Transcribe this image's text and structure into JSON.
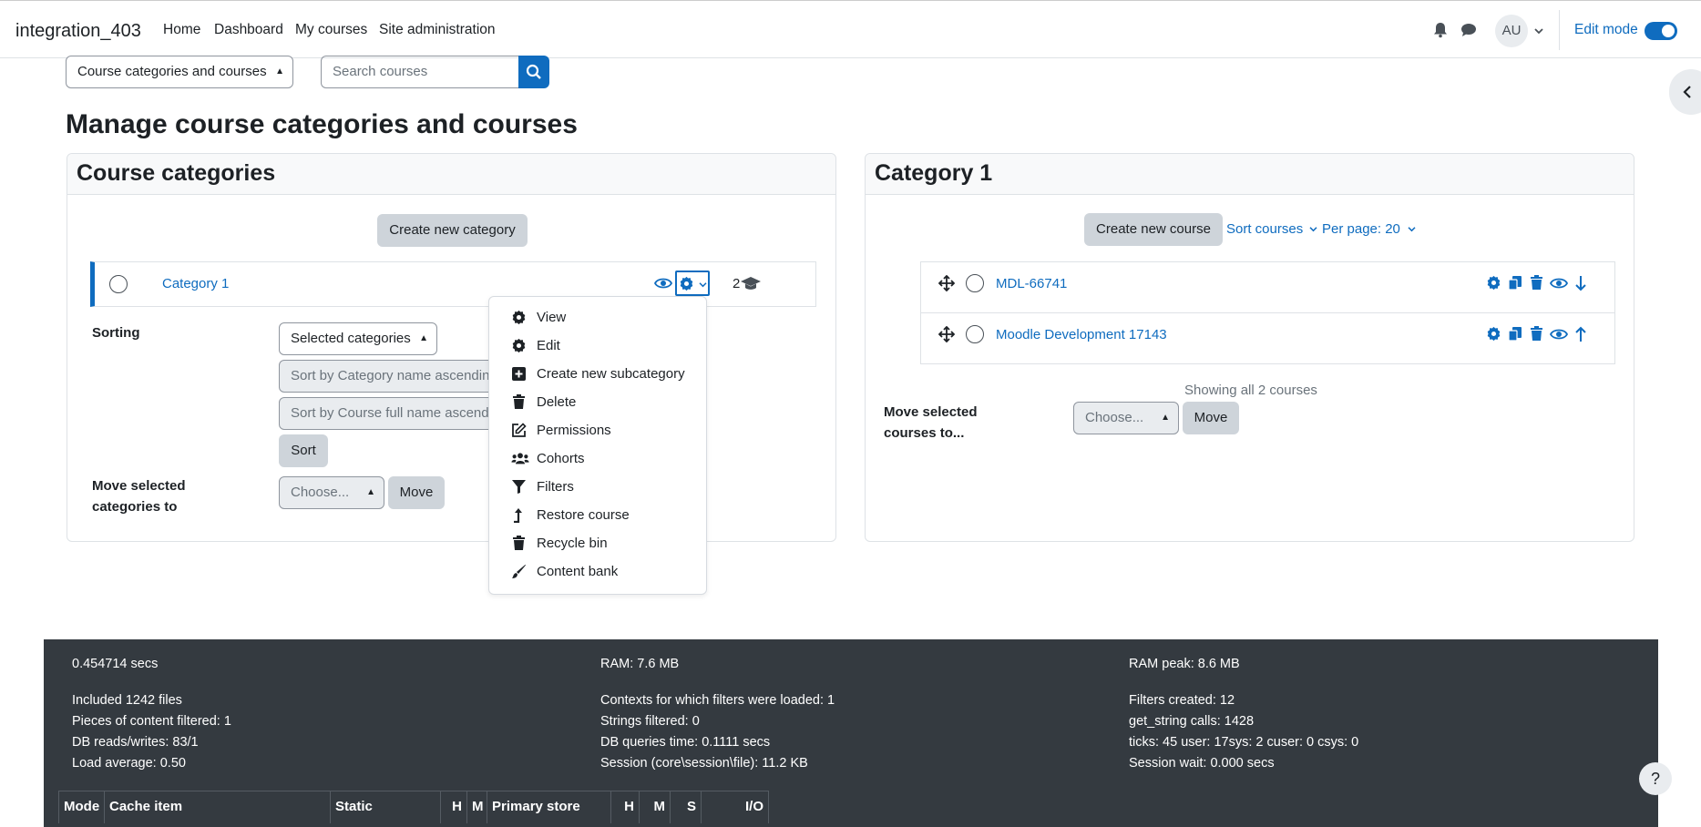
{
  "navbar": {
    "site_name": "integration_403",
    "links": [
      "Home",
      "Dashboard",
      "My courses",
      "Site administration"
    ],
    "avatar_initials": "AU",
    "edit_mode_label": "Edit mode"
  },
  "top_controls": {
    "view_select": "Course categories and courses",
    "search_placeholder": "Search courses"
  },
  "page_title": "Manage course categories and courses",
  "categories_panel": {
    "title": "Course categories",
    "create_button": "Create new category",
    "category": {
      "name": "Category 1",
      "course_count": "2"
    },
    "sorting_label": "Sorting",
    "sort_select": "Selected categories",
    "sort_by_category": "Sort by Category name ascending",
    "sort_by_course": "Sort by Course full name ascending",
    "sort_button": "Sort",
    "move_label_line1": "Move selected",
    "move_label_line2": "categories to",
    "move_select": "Choose...",
    "move_button": "Move"
  },
  "category_menu": {
    "items": [
      {
        "label": "View",
        "icon": "gear-icon"
      },
      {
        "label": "Edit",
        "icon": "gear-icon"
      },
      {
        "label": "Create new subcategory",
        "icon": "plus-square-icon"
      },
      {
        "label": "Delete",
        "icon": "trash-icon"
      },
      {
        "label": "Permissions",
        "icon": "pencil-square-icon"
      },
      {
        "label": "Cohorts",
        "icon": "users-icon"
      },
      {
        "label": "Filters",
        "icon": "filter-icon"
      },
      {
        "label": "Restore course",
        "icon": "level-up-icon"
      },
      {
        "label": "Recycle bin",
        "icon": "trash-icon"
      },
      {
        "label": "Content bank",
        "icon": "brush-icon"
      }
    ]
  },
  "courses_panel": {
    "title": "Category 1",
    "create_button": "Create new course",
    "sort_courses": "Sort courses",
    "per_page": "Per page: 20",
    "courses": [
      {
        "name": "MDL-66741"
      },
      {
        "name": "Moodle Development 17143"
      }
    ],
    "showing_text": "Showing all 2 courses",
    "move_label_line1": "Move selected",
    "move_label_line2": "courses to...",
    "move_select": "Choose...",
    "move_button": "Move"
  },
  "footer": {
    "time": "0.454714 secs",
    "ram": "RAM: 7.6 MB",
    "ram_peak": "RAM peak: 8.6 MB",
    "col1": [
      "Included 1242 files",
      "Pieces of content filtered: 1",
      "DB reads/writes: 83/1",
      "Load average: 0.50"
    ],
    "col2": [
      "Contexts for which filters were loaded: 1",
      "Strings filtered: 0",
      "DB queries time: 0.1111 secs",
      "Session (core\\session\\file): 11.2 KB"
    ],
    "col3": [
      "Filters created: 12",
      "get_string calls: 1428",
      "ticks: 45 user: 17sys: 2 cuser: 0 csys: 0",
      "Session wait: 0.000 secs"
    ],
    "cache_table_headers": [
      "Mode",
      "Cache item",
      "Static",
      "H",
      "M",
      "Primary store",
      "H",
      "M",
      "S",
      "I/O"
    ]
  },
  "help_label": "?",
  "colors": {
    "primary": "#0f6cbf",
    "footer_bg": "#343a40",
    "button_gray": "#ced4da"
  }
}
